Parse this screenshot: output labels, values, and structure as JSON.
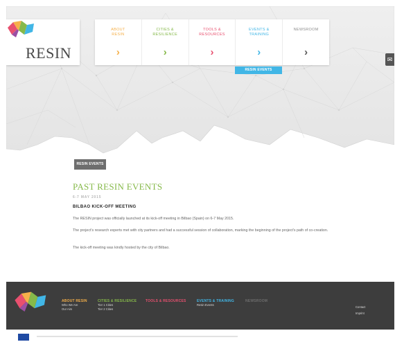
{
  "header": {
    "logo_text": "RESIN",
    "nav": [
      {
        "label": "ABOUT\nRESIN",
        "color": "#f5b04a"
      },
      {
        "label": "CITIES &\nRESILIENCE",
        "color": "#86b94a"
      },
      {
        "label": "TOOLS &\nRESOURCES",
        "color": "#e8506f"
      },
      {
        "label": "EVENTS &\nTRAINING",
        "color": "#41b6e6"
      },
      {
        "label": "NEWSROOM",
        "color": "#8c8c8c"
      }
    ],
    "nav_arrow": "›",
    "active_sub_tab": "RESIN EVENTS",
    "side_tab_icon": "mail-icon"
  },
  "breadcrumb": "RESIN EVENTS",
  "article": {
    "title": "PAST RESIN EVENTS",
    "date": "6-7 MAY 2015",
    "subtitle": "BILBAO KICK-OFF MEETING",
    "paragraphs": [
      "The RESIN project was officially launched at its kick-off meeting in Bilbao (Spain) on 6-7 May 2015.",
      "The project's research experts met with city partners and had a successful session of collaboration, marking the beginning of the project's path of co-creation.",
      "The kick-off meeting was kindly hosted by the city of Bilbao."
    ]
  },
  "footer": {
    "columns": [
      {
        "heading": "ABOUT RESIN",
        "color": "#f5b04a",
        "links": [
          "Who We Are",
          "Our Aim"
        ]
      },
      {
        "heading": "CITIES & RESILIENCE",
        "color": "#86b94a",
        "links": [
          "Tier 1 Cities",
          "Tier 2 Cities"
        ]
      },
      {
        "heading": "TOOLS & RESOURCES",
        "color": "#e8506f",
        "links": []
      },
      {
        "heading": "EVENTS & TRAINING",
        "color": "#41b6e6",
        "links": [
          "Resin Events"
        ]
      },
      {
        "heading": "NEWSROOM",
        "color": "#6e6e6e",
        "links": []
      }
    ],
    "right_links": [
      "Contact",
      "Imprint"
    ]
  },
  "colors": {
    "accent_blue": "#41b6e6",
    "accent_green": "#86b94a",
    "accent_orange": "#f5b04a",
    "accent_pink": "#e8506f",
    "footer_bg": "#3d3d3d"
  }
}
